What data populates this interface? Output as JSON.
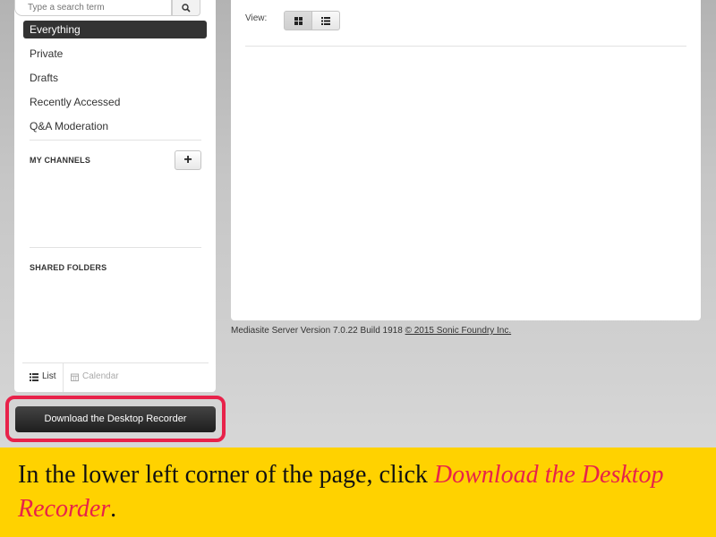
{
  "search": {
    "placeholder": "Type a search term"
  },
  "nav": {
    "items": [
      {
        "label": "Everything",
        "active": true
      },
      {
        "label": "Private",
        "active": false
      },
      {
        "label": "Drafts",
        "active": false
      },
      {
        "label": "Recently Accessed",
        "active": false
      },
      {
        "label": "Q&A Moderation",
        "active": false
      }
    ]
  },
  "channels": {
    "title": "MY CHANNELS",
    "add_label": "+"
  },
  "shared": {
    "title": "SHARED FOLDERS"
  },
  "view_tabs": {
    "list": "List",
    "calendar": "Calendar"
  },
  "download": {
    "label": "Download the Desktop Recorder"
  },
  "main": {
    "view_label": "View:",
    "footer_version": "Mediasite Server Version 7.0.22 Build 1918",
    "footer_link": "© 2015 Sonic Foundry Inc."
  },
  "instruction": {
    "prefix": "In the lower left corner of the page, click ",
    "emphasis": "Download the Desktop Recorder",
    "suffix": "."
  },
  "colors": {
    "highlight": "#e8224a",
    "banner": "#ffd200",
    "active_nav": "#333333"
  }
}
